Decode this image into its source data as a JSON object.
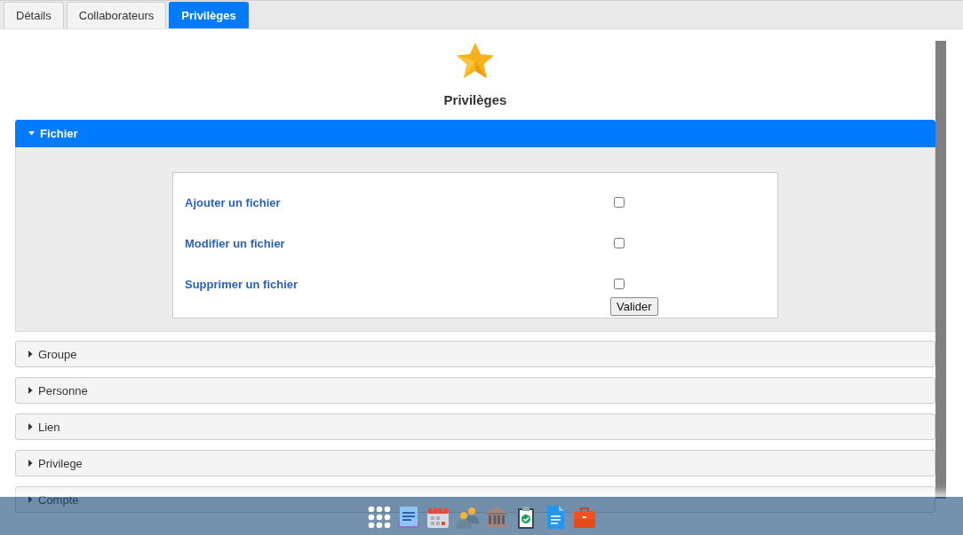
{
  "tabs": [
    {
      "label": "Détails",
      "selected": false
    },
    {
      "label": "Collaborateurs",
      "selected": false
    },
    {
      "label": "Privilèges",
      "selected": true
    }
  ],
  "page_title": "Privilèges",
  "sections": [
    {
      "title": "Fichier",
      "expanded": true,
      "items": [
        {
          "label": "Ajouter un fichier",
          "checked": false
        },
        {
          "label": "Modifier un fichier",
          "checked": false
        },
        {
          "label": "Supprimer un fichier",
          "checked": false
        }
      ],
      "button": "Valider"
    },
    {
      "title": "Groupe",
      "expanded": false
    },
    {
      "title": "Personne",
      "expanded": false
    },
    {
      "title": "Lien",
      "expanded": false
    },
    {
      "title": "Privilege",
      "expanded": false
    },
    {
      "title": "Compte",
      "expanded": false
    }
  ]
}
